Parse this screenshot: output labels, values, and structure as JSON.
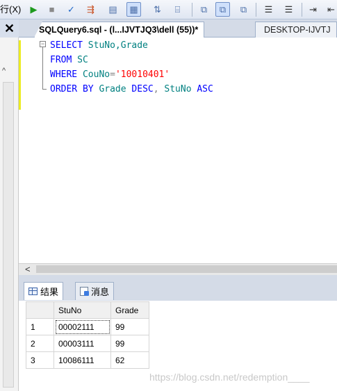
{
  "toolbar": {
    "menu_label": "行(X)",
    "buttons": [
      "play-icon",
      "stop-icon",
      "check-icon",
      "parse-icon",
      "results-to-text-icon",
      "results-to-grid-icon",
      "include-plan-icon",
      "query-options-icon",
      "results-icon-1",
      "results-icon-2",
      "results-icon-3",
      "align-icon-1",
      "align-icon-2",
      "indent-icon"
    ]
  },
  "left_pane": {
    "close_glyph": "✕",
    "scroll_up_glyph": "^"
  },
  "tabs": [
    {
      "label": "SQLQuery6.sql - (l...IJVTJQ3\\dell (55))*",
      "active": true
    },
    {
      "label": "DESKTOP-IJVTJ",
      "active": false
    }
  ],
  "editor": {
    "lines": [
      {
        "keyword": "SELECT",
        "rest": " StuNo,Grade"
      },
      {
        "keyword": "FROM",
        "rest": " SC"
      },
      {
        "keyword": "WHERE",
        "ident": " CouNo",
        "op": "=",
        "string": "'10010401'"
      },
      {
        "keyword": "ORDER BY",
        "ident": " Grade ",
        "keyword2": "DESC",
        "op": ",",
        "ident2": " StuNo ",
        "keyword3": "ASC"
      }
    ]
  },
  "scroll_left_glyph": "<",
  "result_tabs": [
    {
      "label": "结果",
      "icon": "grid-icon"
    },
    {
      "label": "消息",
      "icon": "message-icon"
    }
  ],
  "results": {
    "columns": [
      "",
      "StuNo",
      "Grade"
    ],
    "rows": [
      [
        "1",
        "00002111",
        "99"
      ],
      [
        "2",
        "00003111",
        "99"
      ],
      [
        "3",
        "10086111",
        "62"
      ]
    ]
  },
  "watermark": "https://blog.csdn.net/redemption____",
  "colors": {
    "keyword": "#0000ff",
    "identifier": "#008080",
    "string": "#ff0000",
    "operator": "#808080"
  }
}
